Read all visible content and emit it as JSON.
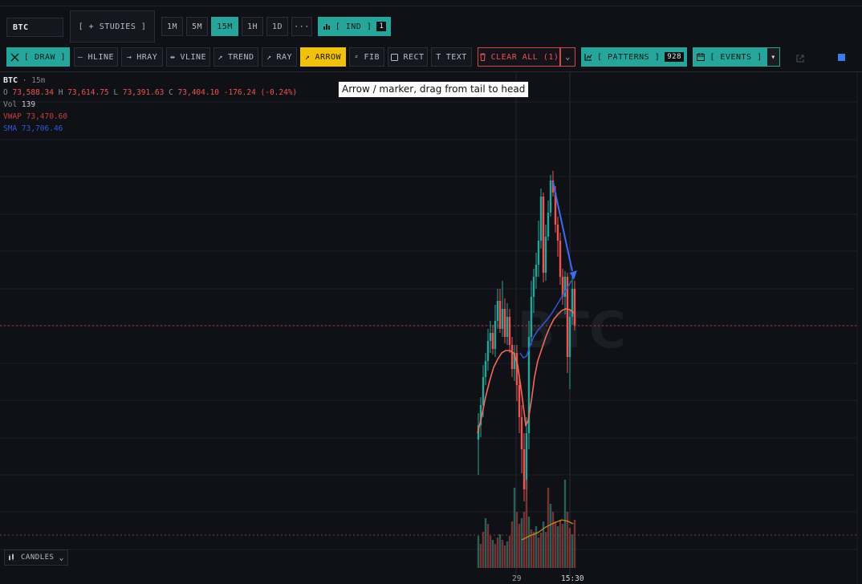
{
  "symbol_input": "BTC",
  "studies_label": "[ + STUDIES ]",
  "timeframes": [
    "1M",
    "5M",
    "15M",
    "1H",
    "1D"
  ],
  "more_label": "···",
  "ind": {
    "label": "[ IND ]",
    "count": "1"
  },
  "toolbar": {
    "draw": "[ DRAW ]",
    "hline": "HLINE",
    "hray": "HRAY",
    "vline": "VLINE",
    "trend": "TREND",
    "ray": "RAY",
    "arrow": "ARROW",
    "fib": "FIB",
    "rect": "RECT",
    "text": "TEXT",
    "clear_all": "CLEAR ALL (1)",
    "patterns": "[ PATTERNS ]",
    "patterns_count": "928",
    "events": "[ EVENTS ]"
  },
  "legend": {
    "symbol": "BTC",
    "interval": "· 15m",
    "o_label": "O",
    "o": "73,588.34",
    "h_label": "H",
    "h": "73,614.75",
    "l_label": "L",
    "l": "73,391.63",
    "c_label": "C",
    "c": "73,404.10",
    "change": "-176.24 (-0.24%)",
    "vol_label": "Vol",
    "vol": "139",
    "vwap_label": "VWAP",
    "vwap": "73,470.60",
    "sma_label": "SMA",
    "sma": "73,706.46"
  },
  "tooltip": "Arrow / marker, drag from tail to head",
  "watermark": "BTC",
  "x_ticks": [
    "29",
    "15:30"
  ],
  "chart_mode": "CANDLES",
  "colors": {
    "up": "#26a69a",
    "down": "#ef5350",
    "vwap": "#f06a5c",
    "sma": "#2f57d6",
    "arrow": "#3b6cf0",
    "active_tool": "#f0c20e",
    "accent": "#26a69a"
  },
  "chart_data": {
    "type": "candlestick",
    "series": [
      {
        "name": "VWAP",
        "values": [
          73470.6
        ]
      },
      {
        "name": "SMA",
        "values": [
          73706.46
        ]
      }
    ],
    "last_candle": {
      "open": 73588.34,
      "high": 73614.75,
      "low": 73391.63,
      "close": 73404.1,
      "volume": 139
    }
  }
}
